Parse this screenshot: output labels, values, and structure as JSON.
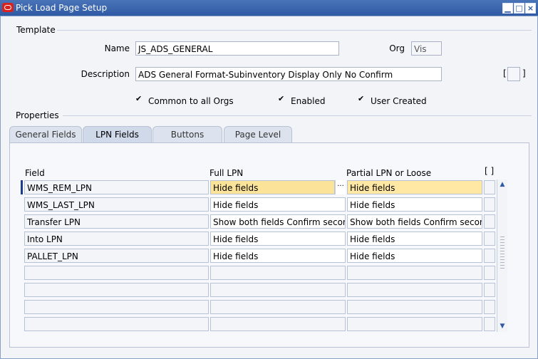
{
  "window": {
    "title": "Pick Load Page Setup",
    "controls": {
      "minimize": "▁",
      "maximize": "□",
      "close": "×"
    }
  },
  "template": {
    "section_label": "Template",
    "name_label": "Name",
    "name_value": "JS_ADS_GENERAL",
    "org_label": "Org",
    "org_value": "Vis",
    "description_label": "Description",
    "description_value": "ADS General Format-Subinventory Display Only No Confirm",
    "flex_bracket_left": "[",
    "flex_bracket_right": "]",
    "checkboxes": [
      {
        "label": "Common to all Orgs",
        "checked": "✔"
      },
      {
        "label": "Enabled",
        "checked": "✔"
      },
      {
        "label": "User Created",
        "checked": "✔"
      }
    ]
  },
  "properties": {
    "section_label": "Properties",
    "tabs": [
      {
        "label": "General Fields",
        "active": false
      },
      {
        "label": "LPN Fields",
        "active": true
      },
      {
        "label": "Buttons",
        "active": false
      },
      {
        "label": "Page Level",
        "active": false
      }
    ],
    "columns": {
      "field": "Field",
      "full_lpn": "Full LPN",
      "partial_lpn": "Partial LPN or Loose",
      "extra": "[ ]"
    },
    "rows": [
      {
        "field": "WMS_REM_LPN",
        "full": "Hide fields",
        "partial": "Hide fields"
      },
      {
        "field": "WMS_LAST_LPN",
        "full": "Hide fields",
        "partial": "Hide fields"
      },
      {
        "field": "Transfer LPN",
        "full": "Show both fields Confirm seconc",
        "partial": "Show both fields Confirm seconc"
      },
      {
        "field": "Into LPN",
        "full": "Hide fields",
        "partial": "Hide fields"
      },
      {
        "field": "PALLET_LPN",
        "full": "Hide fields",
        "partial": "Hide fields"
      },
      {
        "field": "",
        "full": "",
        "partial": ""
      },
      {
        "field": "",
        "full": "",
        "partial": ""
      },
      {
        "field": "",
        "full": "",
        "partial": ""
      },
      {
        "field": "",
        "full": "",
        "partial": ""
      }
    ],
    "scroll_up": "▲",
    "scroll_down": "▼",
    "lov_dots": "···"
  }
}
